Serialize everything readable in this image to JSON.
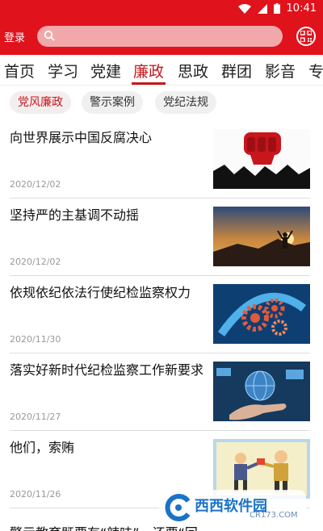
{
  "status": {
    "time": "10:41"
  },
  "header": {
    "login": "登录",
    "search_placeholder": ""
  },
  "tabs": [
    "首页",
    "学习",
    "党建",
    "廉政",
    "思政",
    "群团",
    "影音",
    "专"
  ],
  "active_tab": "廉政",
  "chips": [
    "党风廉政",
    "警示案例",
    "党纪法规"
  ],
  "active_chip": "党风廉政",
  "news": [
    {
      "title": "向世界展示中国反腐决心",
      "date": "2020/12/02",
      "thumb": "fist-icon"
    },
    {
      "title": "坚持严的主基调不动摇",
      "date": "2020/12/02",
      "thumb": "mountain-photo"
    },
    {
      "title": "依规依纪依法行使纪检监察权力",
      "date": "2020/11/30",
      "thumb": "gears-icon"
    },
    {
      "title": "落实好新时代纪检监察工作新要求",
      "date": "2020/11/27",
      "thumb": "hand-globe-photo"
    },
    {
      "title": "他们，索贿",
      "date": "2020/11/26",
      "thumb": "cartoon-bribe"
    }
  ],
  "partial_title": "警示教育既要有“辣味”，还要“回",
  "watermark": {
    "title": "西西软件园",
    "url": "CR173.COM"
  },
  "colors": {
    "brand": "#e0121b",
    "accent": "#c8161d"
  }
}
